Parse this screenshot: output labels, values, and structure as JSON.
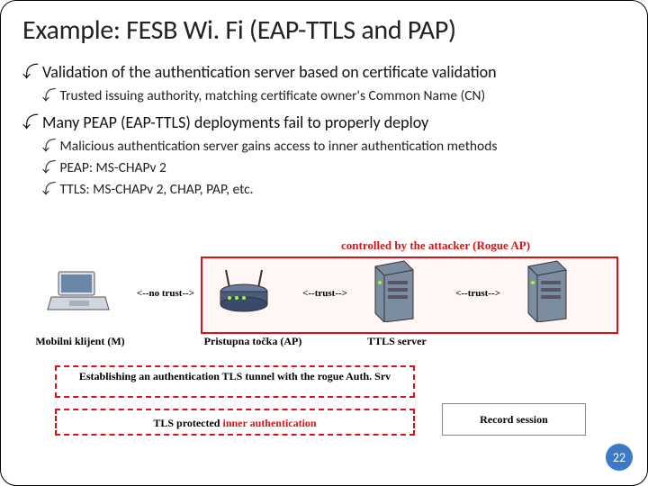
{
  "title": "Example: FESB Wi. Fi (EAP-TTLS and PAP)",
  "bullets": {
    "b1": "Validation of the authentication server based on certificate validation",
    "b1a": "Trusted issuing authority, matching certificate owner's Common Name (CN)",
    "b2": "Many PEAP (EAP-TTLS) deployments fail to properly deploy",
    "b2a": "Malicious authentication server gains access to inner authentication methods",
    "b2b": "PEAP: MS-CHAPv 2",
    "b2c": "TTLS: MS-CHAPv 2, CHAP, PAP, etc."
  },
  "rogue_caption": "controlled by the attacker (Rogue AP)",
  "trust": {
    "none": "<--no trust-->",
    "t1": "<--trust-->",
    "t2": "<--trust-->"
  },
  "nodes": {
    "client": "Mobilni klijent (M)",
    "ap": "Pristupna točka (AP)",
    "ttls": "TTLS server"
  },
  "tls1": "Establishing an authentication TLS tunnel with the rogue Auth. Srv",
  "tls2_pre": "TLS protected ",
  "tls2_red": "inner authentication",
  "record": "Record session",
  "page": "22"
}
